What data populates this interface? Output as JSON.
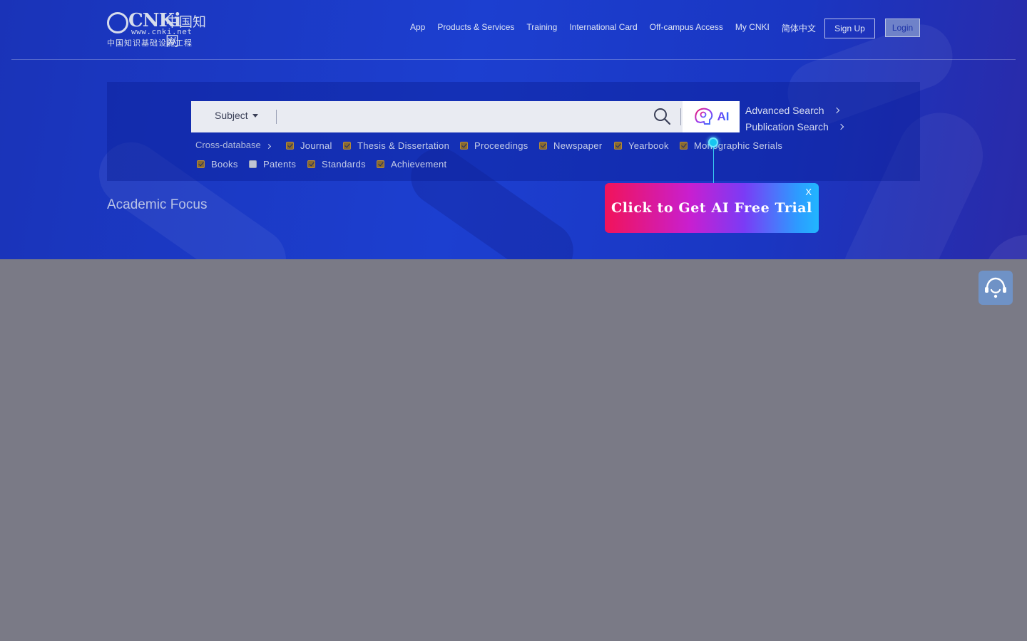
{
  "header": {
    "logo": {
      "brand": "CNKi",
      "brand_cn": "中国知网",
      "url": "www.cnki.net",
      "tagline": "中国知识基础设施工程"
    },
    "nav": [
      {
        "label": "App"
      },
      {
        "label": "Products & Services"
      },
      {
        "label": "Training"
      },
      {
        "label": "International Card"
      },
      {
        "label": "Off-campus Access"
      },
      {
        "label": "My CNKI"
      },
      {
        "label": "简体中文"
      }
    ],
    "signup_label": "Sign Up",
    "login_label": "Login"
  },
  "search": {
    "subject_label": "Subject",
    "input_value": "",
    "ai_label": "AI",
    "advanced_label": "Advanced Search",
    "publication_label": "Publication Search"
  },
  "databases": {
    "cross_label": "Cross-database",
    "items": [
      {
        "label": "Journal",
        "checked": true
      },
      {
        "label": "Thesis & Dissertation",
        "checked": true
      },
      {
        "label": "Proceedings",
        "checked": true
      },
      {
        "label": "Newspaper",
        "checked": true
      },
      {
        "label": "Yearbook",
        "checked": true
      },
      {
        "label": "Monographic Serials",
        "checked": true
      },
      {
        "label": "Books",
        "checked": true
      },
      {
        "label": "Patents",
        "checked": false
      },
      {
        "label": "Standards",
        "checked": true
      },
      {
        "label": "Achievement",
        "checked": true
      }
    ]
  },
  "academic_focus_label": "Academic Focus",
  "promo": {
    "label": "Click to Get AI Free Trial",
    "close_label": "X"
  },
  "colors": {
    "hero_blue": "#1c3fd0",
    "page_gray": "#7a7a86",
    "promo_start": "#f1135a",
    "promo_end": "#21b6ff",
    "pin_cyan": "#16c6f0"
  }
}
